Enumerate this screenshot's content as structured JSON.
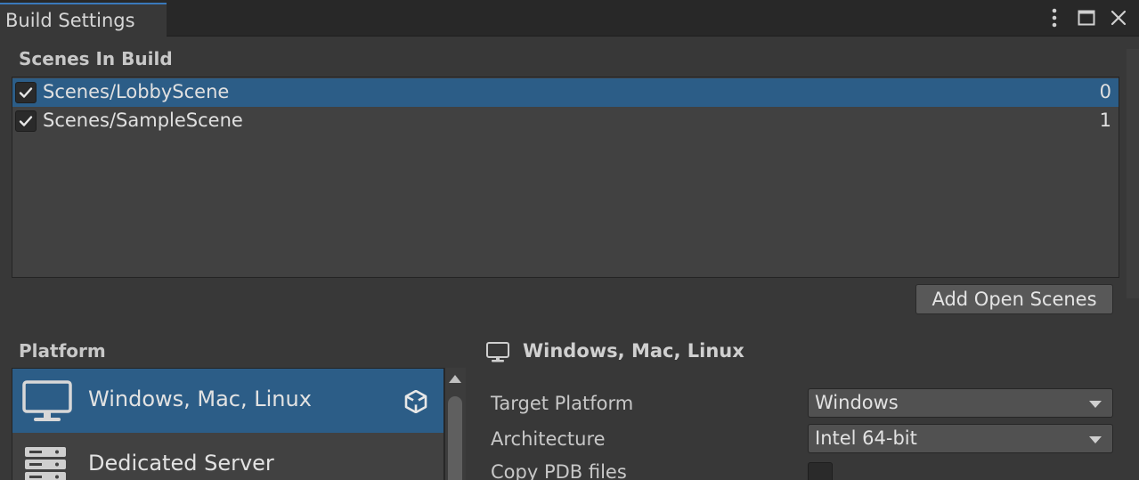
{
  "window": {
    "tab_title": "Build Settings"
  },
  "scenes": {
    "header": "Scenes In Build",
    "items": [
      {
        "name": "Scenes/LobbyScene",
        "index": "0",
        "checked": true,
        "selected": true
      },
      {
        "name": "Scenes/SampleScene",
        "index": "1",
        "checked": true,
        "selected": false
      }
    ],
    "add_open_scenes_label": "Add Open Scenes"
  },
  "platform": {
    "header": "Platform",
    "items": [
      {
        "label": "Windows, Mac, Linux",
        "icon": "monitor-icon",
        "selected": true
      },
      {
        "label": "Dedicated Server",
        "icon": "server-icon",
        "selected": false
      }
    ]
  },
  "settings": {
    "title": "Windows, Mac, Linux",
    "target_platform_label": "Target Platform",
    "target_platform_value": "Windows",
    "architecture_label": "Architecture",
    "architecture_value": "Intel 64-bit",
    "copy_pdb_label": "Copy PDB files"
  },
  "colors": {
    "selection": "#2c5d87",
    "tab_accent": "#3a79bb",
    "background": "#383838"
  }
}
